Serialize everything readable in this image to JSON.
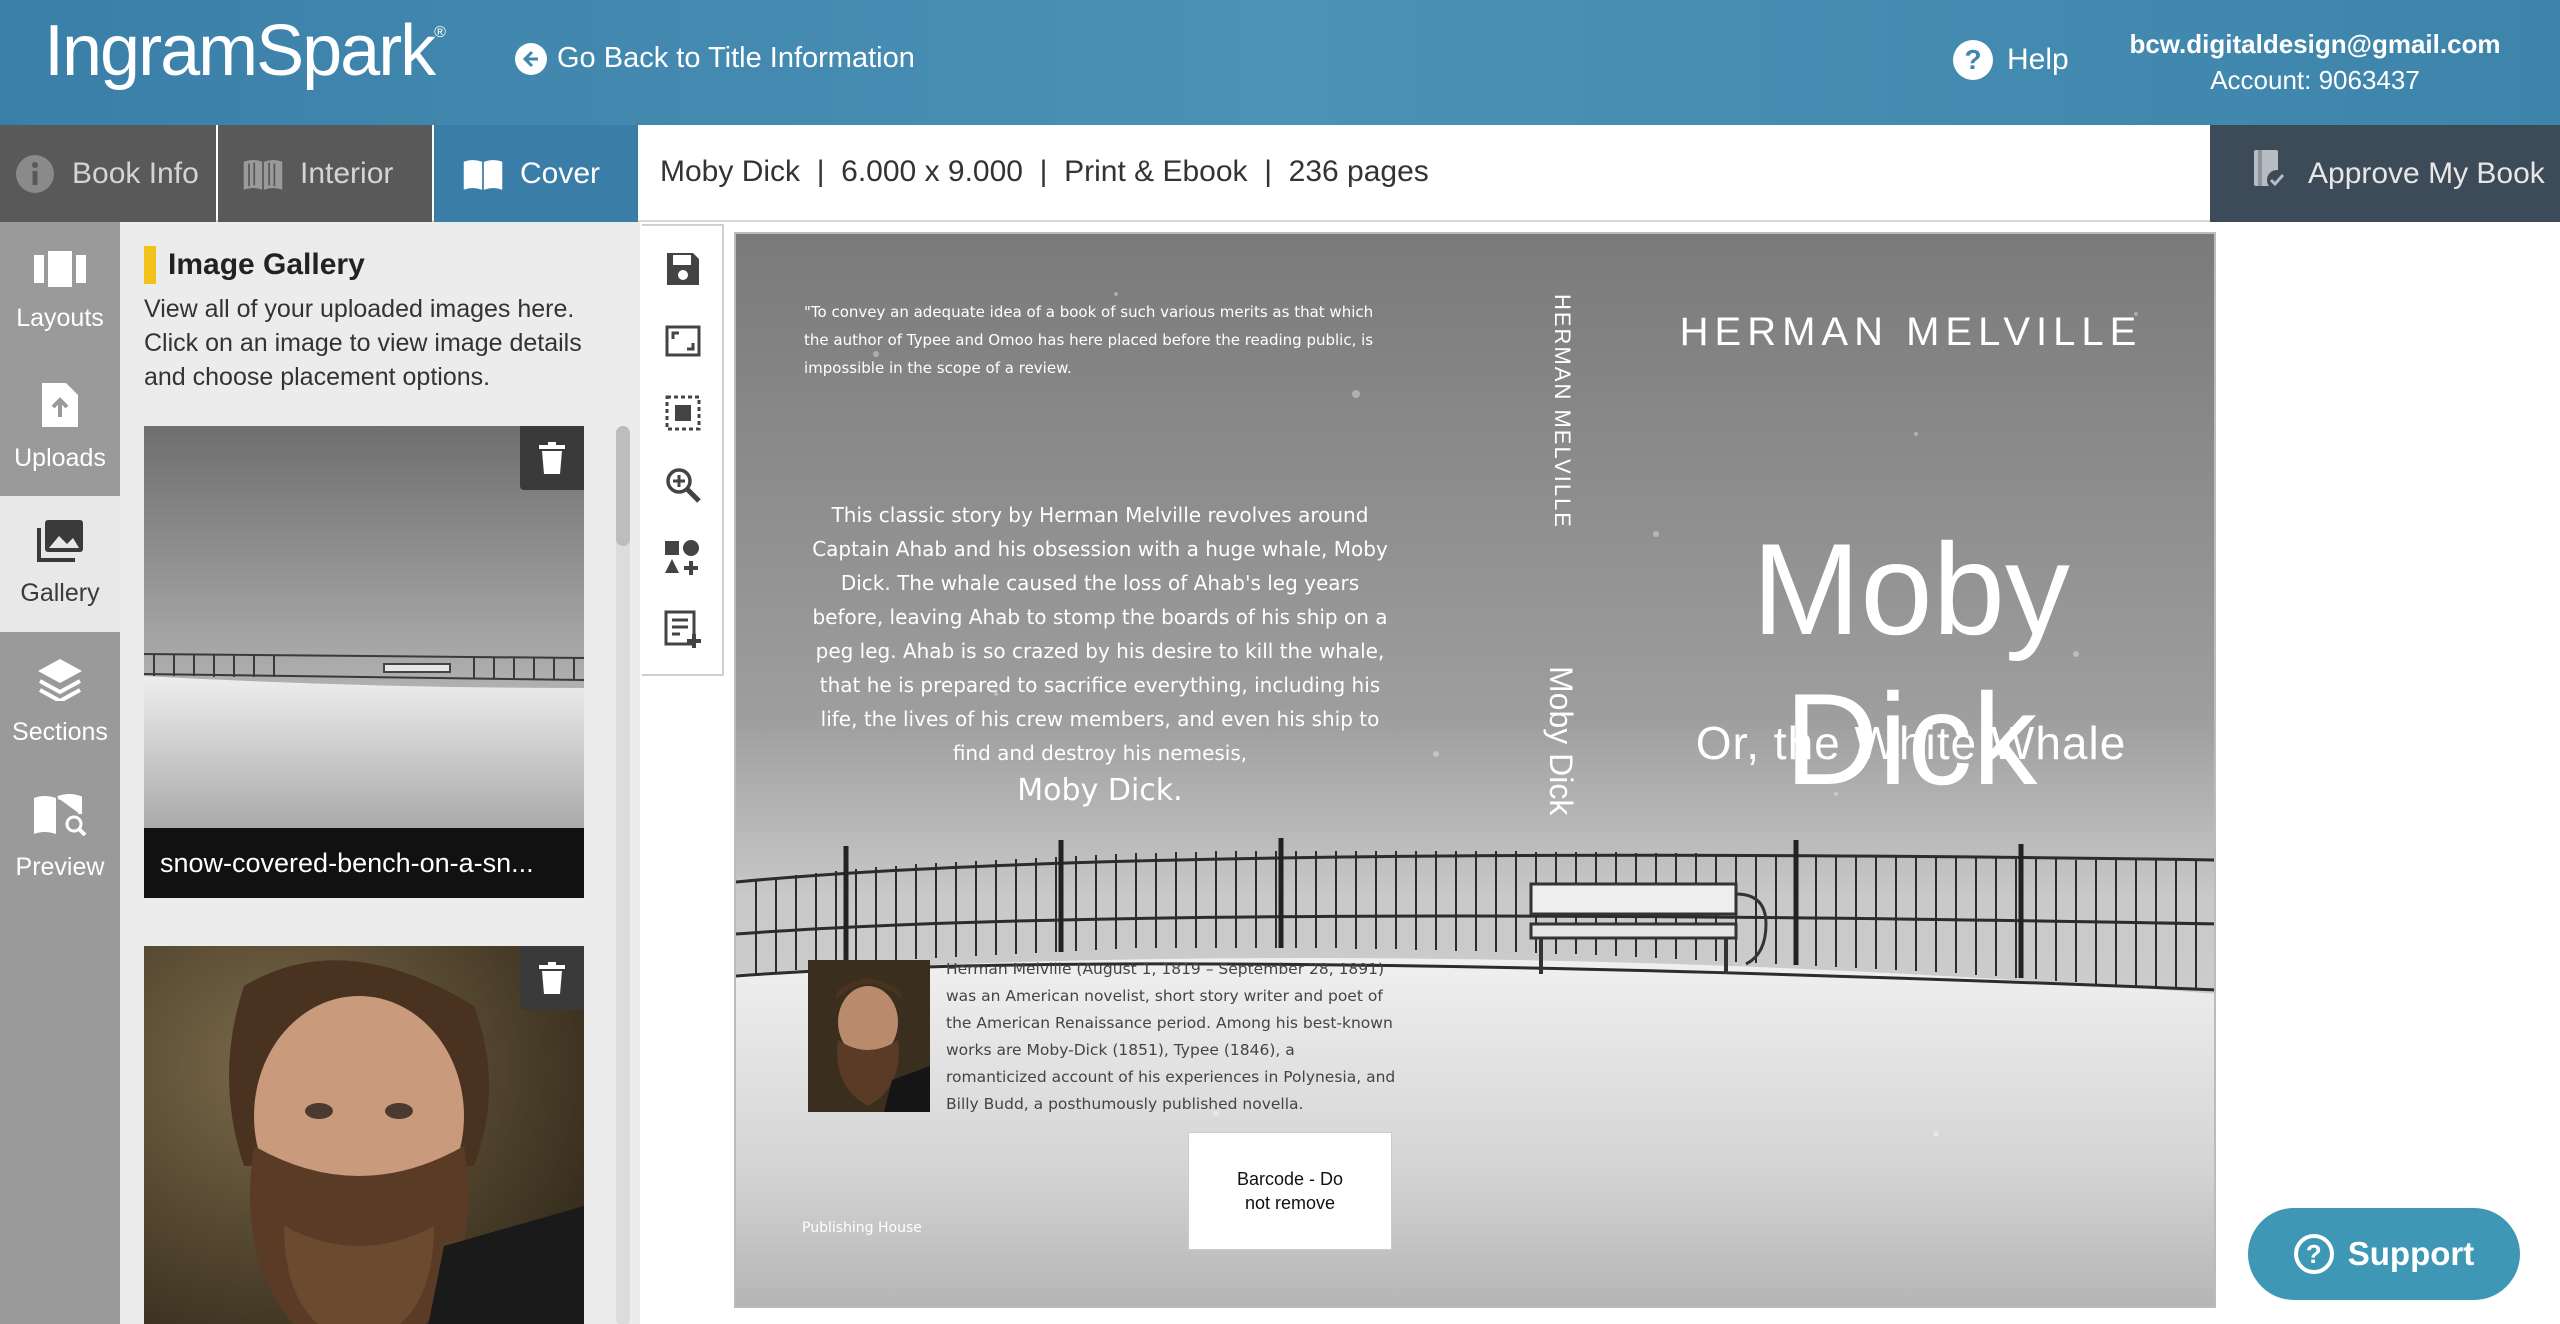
{
  "header": {
    "logo": "IngramSpark",
    "logo_mark": "®",
    "back_link": "Go Back to Title Information",
    "help": "Help",
    "email": "bcw.digitaldesign@gmail.com",
    "account": "Account: 9063437"
  },
  "tabs": [
    {
      "label": "Book Info",
      "icon": "info-icon"
    },
    {
      "label": "Interior",
      "icon": "open-book-icon"
    },
    {
      "label": "Cover",
      "icon": "cover-book-icon"
    }
  ],
  "book_meta": "Moby Dick  |  6.000 x 9.000  |  Print & Ebook  |  236 pages",
  "approve": "Approve My Book",
  "rail": [
    {
      "label": "Layouts",
      "icon": "layouts-icon"
    },
    {
      "label": "Uploads",
      "icon": "upload-icon"
    },
    {
      "label": "Gallery",
      "icon": "gallery-icon"
    },
    {
      "label": "Sections",
      "icon": "layers-icon"
    },
    {
      "label": "Preview",
      "icon": "preview-icon"
    }
  ],
  "gallery": {
    "title": "Image Gallery",
    "description": "View all of your uploaded images here. Click on an image to view image details and choose placement options.",
    "items": [
      {
        "caption": "snow-covered-bench-on-a-sn..."
      },
      {
        "caption": ""
      }
    ]
  },
  "cover": {
    "quote": "\"To convey an adequate idea of a book of such various merits as that which the author of Typee and Omoo has here placed before the reading public, is impossible in the scope of a review.",
    "blurb": "This classic story by Herman Melville revolves around Captain Ahab and his obsession with a huge whale, Moby Dick. The whale caused the loss of Ahab's leg years before, leaving Ahab to stomp the boards of his ship on a peg leg. Ahab is so crazed by his desire to kill the whale, that he is prepared to sacrifice everything, including his life, the lives of his crew members, and even his ship to find and destroy his nemesis,",
    "blurb_end": "Moby Dick.",
    "spine_author": "HERMAN MELVILLE",
    "spine_title": "Moby Dick",
    "front_author": "HERMAN MELVILLE",
    "front_title": "Moby Dick",
    "front_subtitle": "Or, the White Whale",
    "bio": "Herman Melville (August 1, 1819 – September 28, 1891) was an American novelist, short story writer and poet of the American Renaissance period. Among his best-known works are Moby-Dick (1851), Typee (1846), a romanticized account of his experiences in Polynesia, and Billy Budd, a posthumously published novella.",
    "barcode": "Barcode - Do not remove",
    "publisher": "Publishing House"
  },
  "support": "Support",
  "colors": {
    "header": "#4a8fb5",
    "active_tab": "#3a7ea8",
    "approve": "#3d4a57",
    "accent_bar": "#f2c21a",
    "support": "#3f97b6"
  }
}
